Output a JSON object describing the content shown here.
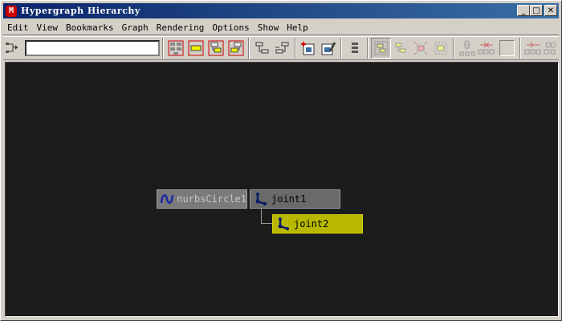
{
  "window": {
    "title": "Hypergraph Hierarchy",
    "app_icon_glyph": "M",
    "minimize": "_",
    "maximize": "□",
    "close": "✕"
  },
  "menu": {
    "items": [
      "Edit",
      "View",
      "Bookmarks",
      "Graph",
      "Rendering",
      "Options",
      "Show",
      "Help"
    ]
  },
  "toolbar": {
    "search_value": "",
    "count_label": "0",
    "icons": [
      "input-output-connections-icon",
      "scene-hierarchy-icon",
      "input-connections-icon",
      "output-connections-icon",
      "both-connections-icon",
      "graph-up-icon",
      "graph-down-icon",
      "add-bookmark-icon",
      "edit-bookmark-icon",
      "attribute-list-icon",
      "frame-all-icon",
      "frame-selection-icon",
      "layout-expand-icon",
      "layout-collapse-icon",
      "connection-graph-icon"
    ]
  },
  "graph": {
    "nodes": [
      {
        "label": "nurbsCircle1",
        "icon": "nurbs-curve-icon"
      },
      {
        "label": "joint1",
        "icon": "joint-icon"
      },
      {
        "label": "joint2",
        "icon": "joint-icon",
        "selected": true
      }
    ]
  },
  "colors": {
    "canvas": "#1c1c1c",
    "selected_node": "#b8b800",
    "node": "#6a6a6a"
  }
}
